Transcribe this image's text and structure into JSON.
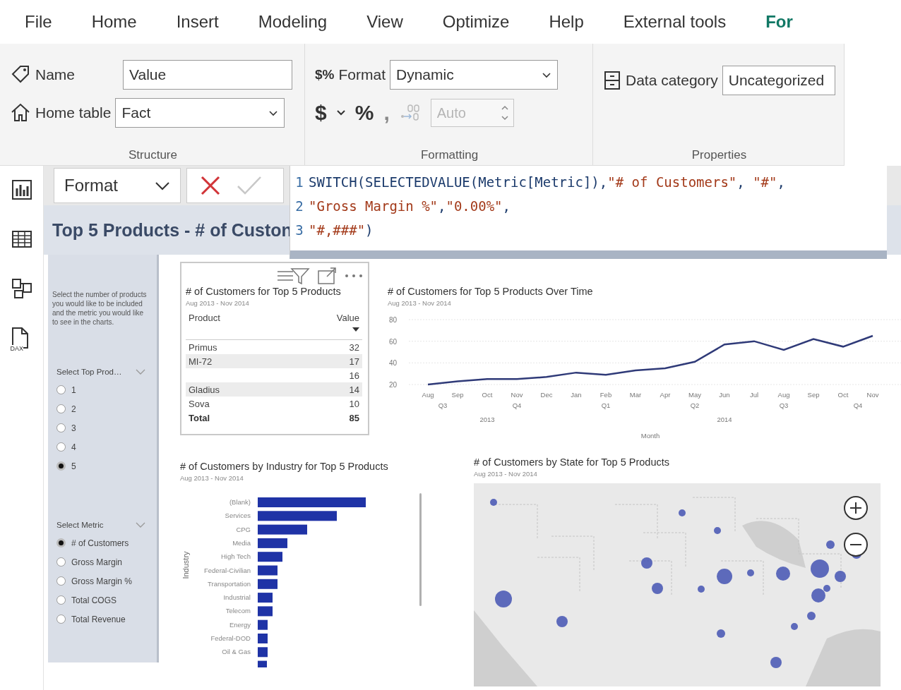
{
  "menu_tabs": [
    {
      "label": "File",
      "selected": false
    },
    {
      "label": "Home",
      "selected": false
    },
    {
      "label": "Insert",
      "selected": false
    },
    {
      "label": "Modeling",
      "selected": false
    },
    {
      "label": "View",
      "selected": false
    },
    {
      "label": "Optimize",
      "selected": false
    },
    {
      "label": "Help",
      "selected": false
    },
    {
      "label": "External tools",
      "selected": false
    },
    {
      "label": "For",
      "selected": true
    }
  ],
  "ribbon": {
    "structure": {
      "label": "Structure",
      "name": {
        "label": "Name",
        "value": "Value"
      },
      "home_table": {
        "label": "Home table",
        "value": "Fact"
      }
    },
    "formatting": {
      "label": "Formatting",
      "format_icon": "$%",
      "format": {
        "label": "Format",
        "value": "Dynamic"
      },
      "currency": "$",
      "percent": "%",
      "comma_style": ",",
      "decimals": {
        "placeholder": "Auto",
        "disabled": true
      }
    },
    "properties": {
      "label": "Properties",
      "data_category": {
        "label": "Data category",
        "value": "Uncategorized"
      }
    }
  },
  "rail": [
    {
      "kind": "report"
    },
    {
      "kind": "table"
    },
    {
      "kind": "model"
    },
    {
      "kind": "dax",
      "label": "DAX"
    }
  ],
  "formula_bar": {
    "measure": "Format",
    "lines": [
      {
        "number": "1",
        "code": "SWITCH(SELECTEDVALUE(Metric[Metric]),\"# of Customers\", \"#\","
      },
      {
        "number": "2",
        "code": "\"Gross Margin %\",\"0.00%\","
      },
      {
        "number": "3",
        "code": "\"#,###\")"
      }
    ]
  },
  "page_title": "Top 5 Products - # of Custon",
  "slicer_panel": {
    "description": "Select the number of products you would like to be included and the metric you would like to see in the charts.",
    "slicers": [
      {
        "title": "Select Top Prod…",
        "options": [
          {
            "label": "1",
            "selected": false
          },
          {
            "label": "2",
            "selected": false
          },
          {
            "label": "3",
            "selected": false
          },
          {
            "label": "4",
            "selected": false
          },
          {
            "label": "5",
            "selected": true
          }
        ]
      },
      {
        "title": "Select Metric",
        "options": [
          {
            "label": "# of Customers",
            "selected": true
          },
          {
            "label": "Gross Margin",
            "selected": false
          },
          {
            "label": "Gross Margin %",
            "selected": false
          },
          {
            "label": "Total COGS",
            "selected": false
          },
          {
            "label": "Total Revenue",
            "selected": false
          }
        ]
      }
    ]
  },
  "table_visual": {
    "title": "# of Customers for Top 5 Products",
    "subtitle": "Aug 2013 - Nov 2014",
    "columns": [
      "Product",
      "Value"
    ],
    "rows": [
      {
        "product": "Primus",
        "value": "32"
      },
      {
        "product": "MI-72",
        "value": "17"
      },
      {
        "value": "16"
      },
      {
        "product": "Gladius",
        "value": "14"
      },
      {
        "product": "Sova",
        "value": "10"
      }
    ],
    "total": {
      "label": "Total",
      "value": "85"
    }
  },
  "line_chart": {
    "title": "# of Customers for Top 5 Products Over Time",
    "subtitle": "Aug 2013 - Nov 2014",
    "quarters": [
      "Q3",
      "Q4",
      "Q1",
      "Q2",
      "Q3",
      "Q4"
    ],
    "years": [
      "2013",
      "2014"
    ],
    "chart_data": {
      "type": "line",
      "xlabel": "Month",
      "categories": [
        "Aug",
        "Sep",
        "Oct",
        "Nov",
        "Dec",
        "Jan",
        "Feb",
        "Mar",
        "Apr",
        "May",
        "Jun",
        "Jul",
        "Aug",
        "Sep",
        "Oct",
        "Nov"
      ],
      "series": [
        {
          "color": "#2f3a78",
          "values": [
            20,
            23,
            25,
            25,
            27,
            31,
            29,
            33,
            35,
            41,
            57,
            60,
            52,
            62,
            55,
            65
          ]
        }
      ],
      "ylim": [
        20,
        80
      ],
      "yticks": [
        20,
        40,
        60,
        80
      ]
    }
  },
  "bar_chart": {
    "title": "# of Customers by Industry for Top 5 Products",
    "subtitle": "Aug 2013 - Nov 2014",
    "axis_title": "Industry",
    "categories": [
      "(Blank)",
      "Services",
      "CPG",
      "Media",
      "High Tech",
      "Federal-Civilian",
      "Transportation",
      "Industrial",
      "Telecom",
      "Energy",
      "Federal-DOD",
      "Oil & Gas"
    ]
  },
  "map": {
    "title": "# of Customers by State for Top 5 Products",
    "subtitle": "Aug 2013 - Nov 2014"
  }
}
